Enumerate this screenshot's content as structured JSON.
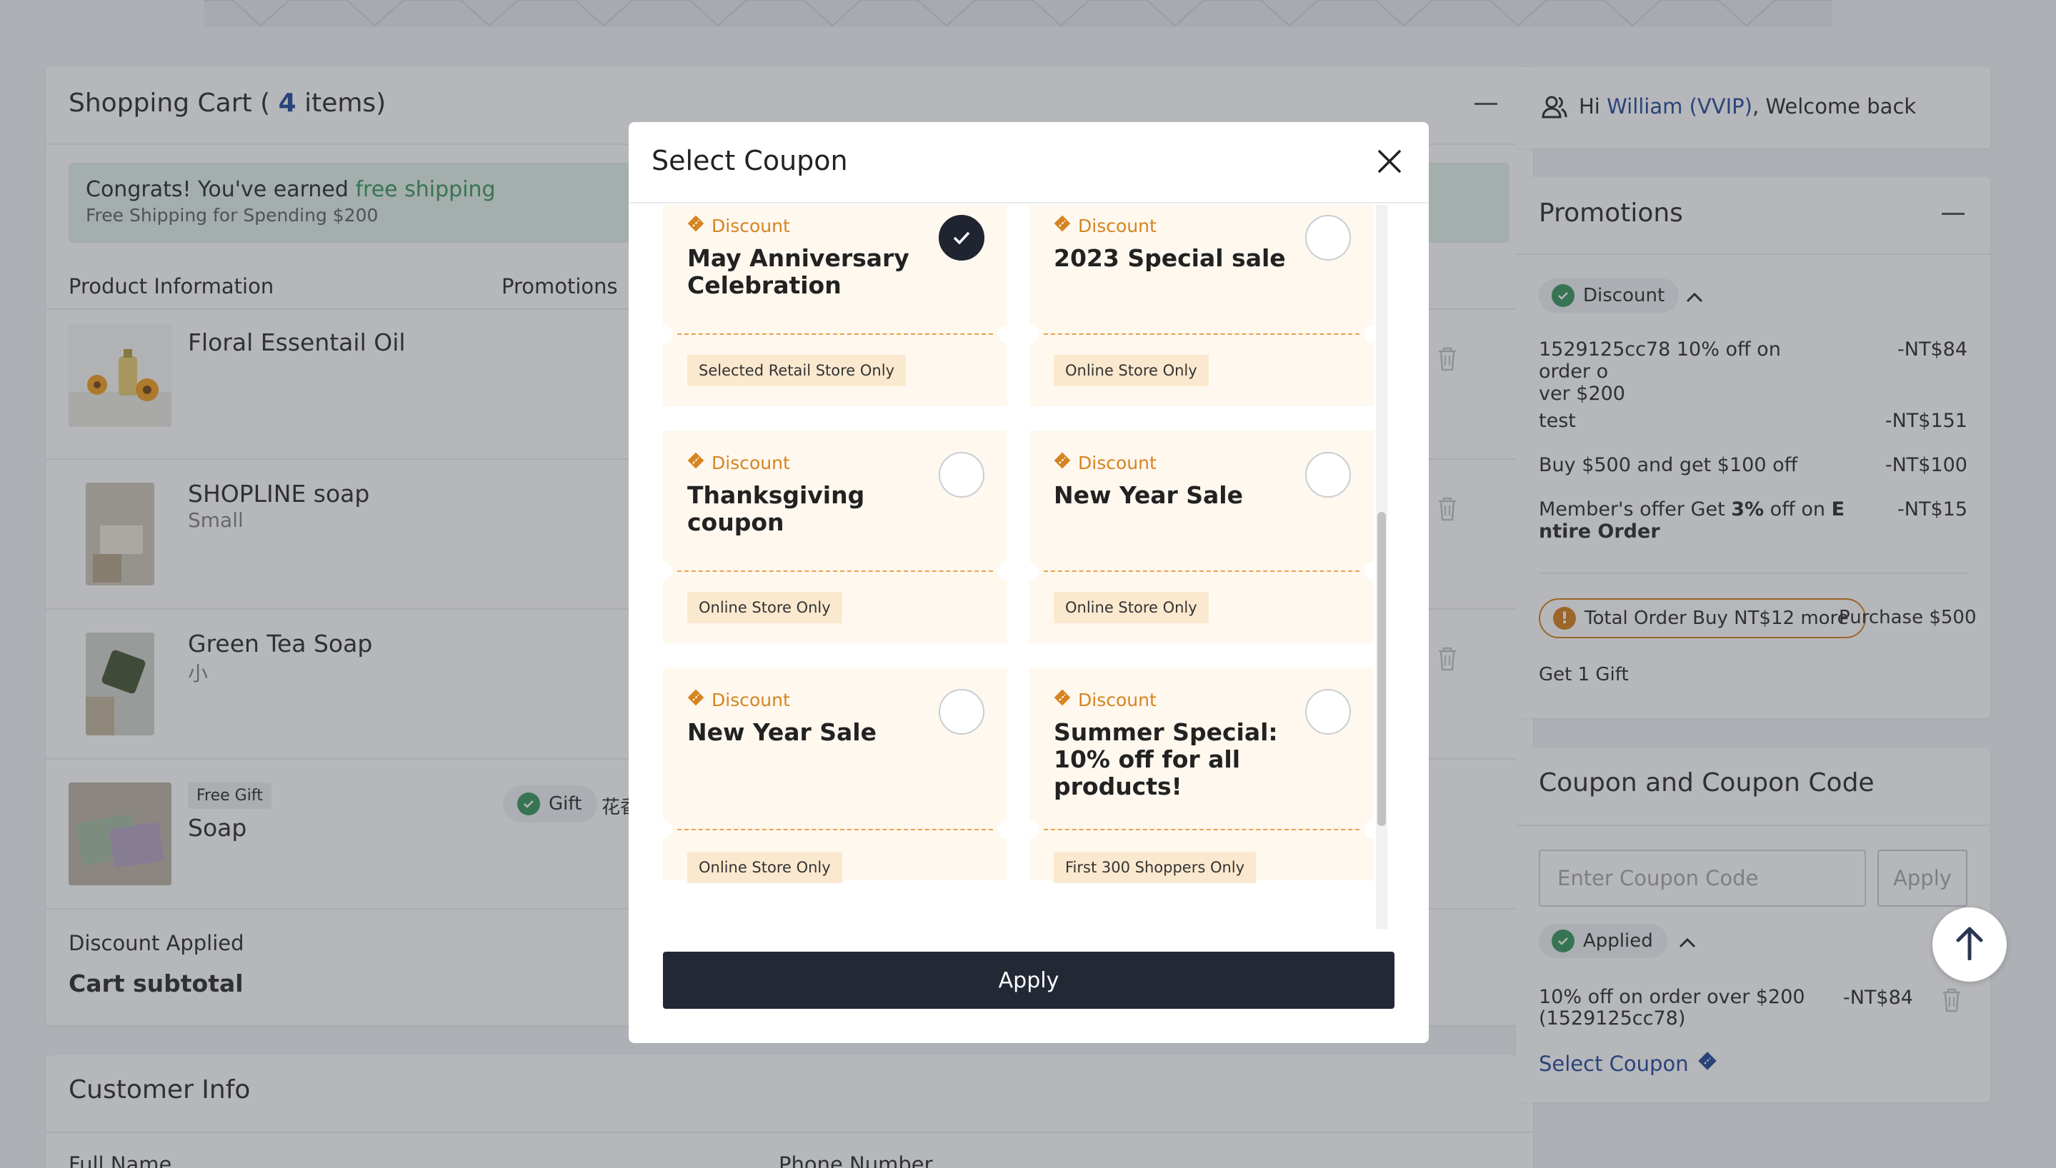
{
  "cart": {
    "title_prefix": "Shopping Cart (",
    "count": "4",
    "title_suffix": "items)",
    "shipping_congrats": "Congrats! You've earned",
    "shipping_highlight": "free shipping",
    "shipping_note": "Free Shipping for Spending $200",
    "col_product": "Product Information",
    "col_promotions": "Promotions",
    "items": [
      {
        "name": "Floral Essentail Oil",
        "variant": ""
      },
      {
        "name": "SHOPLINE soap",
        "variant": "Small"
      },
      {
        "name": "Green Tea Soap",
        "variant": "小"
      },
      {
        "name": "Soap",
        "variant": "",
        "tag": "Free Gift",
        "promo_label": "Gift",
        "promo_extra": "花香"
      }
    ],
    "discount_applied": "Discount Applied",
    "subtotal": "Cart subtotal"
  },
  "customer": {
    "title": "Customer Info",
    "full_name": "Full Name",
    "phone": "Phone Number"
  },
  "welcome": {
    "hi": "Hi",
    "name": "William (VVIP)",
    "rest": ", Welcome back"
  },
  "promotions": {
    "title": "Promotions",
    "badge": "Discount",
    "rows": [
      {
        "text": "1529125cc78 10% off on order over $200",
        "line1": "1529125cc78 10% off on order o",
        "line2": "ver $200",
        "amount": "-NT$84"
      },
      {
        "text": "test",
        "amount": "-NT$151"
      },
      {
        "text": "Buy $500 and get $100 off",
        "amount": "-NT$100"
      },
      {
        "line1_a": "Member's offer Get ",
        "line1_b": "3%",
        "line1_c": " off on ",
        "line1_d": "E",
        "line2": "ntire Order",
        "amount": "-NT$15"
      }
    ],
    "alert": "Total Order Buy NT$12 more",
    "alert_side": "Purchase $500",
    "gift": "Get 1 Gift"
  },
  "coupon_panel": {
    "title": "Coupon and Coupon Code",
    "placeholder": "Enter Coupon Code",
    "apply": "Apply",
    "status": "Applied",
    "applied_line1": "10% off on order over $200",
    "applied_line2": "(1529125cc78)",
    "applied_amount": "-NT$84",
    "select_link": "Select Coupon"
  },
  "modal": {
    "title": "Select Coupon",
    "apply": "Apply",
    "coupons": [
      {
        "type": "Discount",
        "name": "May Anniversary Celebration",
        "scope": "Selected Retail Store Only",
        "selected": true
      },
      {
        "type": "Discount",
        "name": "2023 Special sale",
        "scope": "Online Store Only",
        "selected": false
      },
      {
        "type": "Discount",
        "name": "Thanksgiving coupon",
        "scope": "Online Store Only",
        "selected": false
      },
      {
        "type": "Discount",
        "name": "New Year Sale",
        "scope": "Online Store Only",
        "selected": false
      },
      {
        "type": "Discount",
        "name": "New Year Sale",
        "scope": "Online Store Only",
        "selected": false
      },
      {
        "type": "Discount",
        "name": "Summer Special: 10% off for all products!",
        "scope": "First 300 Shoppers Only",
        "selected": false
      }
    ]
  },
  "colors": {
    "accent": "#2a4fa0",
    "success": "#3f9a63",
    "coupon_orange": "#d68420",
    "dark_button": "#222834"
  }
}
